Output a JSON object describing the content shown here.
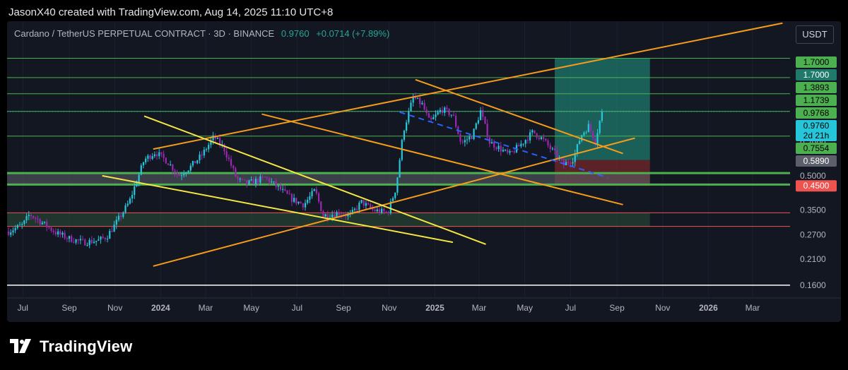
{
  "header": {
    "credit": "JasonX40 created with TradingView.com, Aug 14, 2025 11:10 UTC+8"
  },
  "legend": {
    "symbol": "Cardano / TetherUS PERPETUAL CONTRACT · 3D · BINANCE",
    "price": "0.9760",
    "change": "+0.0714 (+7.89%)"
  },
  "currency_button": "USDT",
  "brand": {
    "name": "TradingView"
  },
  "colors": {
    "pane_bg": "#131722",
    "up": "#26c6da",
    "down": "#9c27b0",
    "channel": "#f59c1a",
    "wedge": "#f5e642",
    "hline": "#4caf50",
    "hline_red": "#ef5350",
    "target_zone": "#1f7a6b",
    "stop_zone": "#7a2a2a",
    "trend_dashed": "#2962ff"
  },
  "chart_data": {
    "type": "candlestick",
    "title": "Cardano / TetherUS PERPETUAL CONTRACT · 3D · BINANCE",
    "y_scale": "log",
    "ylim": [
      0.14,
      2.5
    ],
    "xlim": [
      "2023-06-10",
      "2026-04-20"
    ],
    "x_ticks": [
      {
        "date": "2023-07-01",
        "label": "Jul",
        "bold": false
      },
      {
        "date": "2023-09-01",
        "label": "Sep",
        "bold": false
      },
      {
        "date": "2023-11-01",
        "label": "Nov",
        "bold": false
      },
      {
        "date": "2024-01-01",
        "label": "2024",
        "bold": true
      },
      {
        "date": "2024-03-01",
        "label": "Mar",
        "bold": false
      },
      {
        "date": "2024-05-01",
        "label": "May",
        "bold": false
      },
      {
        "date": "2024-07-01",
        "label": "Jul",
        "bold": false
      },
      {
        "date": "2024-09-01",
        "label": "Sep",
        "bold": false
      },
      {
        "date": "2024-11-01",
        "label": "Nov",
        "bold": false
      },
      {
        "date": "2025-01-01",
        "label": "2025",
        "bold": true
      },
      {
        "date": "2025-03-01",
        "label": "Mar",
        "bold": false
      },
      {
        "date": "2025-05-01",
        "label": "May",
        "bold": false
      },
      {
        "date": "2025-07-01",
        "label": "Jul",
        "bold": false
      },
      {
        "date": "2025-09-01",
        "label": "Sep",
        "bold": false
      },
      {
        "date": "2025-11-01",
        "label": "Nov",
        "bold": false
      },
      {
        "date": "2026-01-01",
        "label": "2026",
        "bold": true
      },
      {
        "date": "2026-03-01",
        "label": "Mar",
        "bold": false
      }
    ],
    "y_ticks": [
      "0.7000",
      "0.5000",
      "0.3500",
      "0.2700",
      "0.2100",
      "0.1600"
    ],
    "price_tags": [
      {
        "value": 1.7,
        "label": "1.7000",
        "bg": "#4caf50",
        "fg": "#000000"
      },
      {
        "value": 1.7,
        "label": "1.7000",
        "bg": "#1f7a6b",
        "fg": "#ffffff"
      },
      {
        "value": 1.3893,
        "label": "1.3893",
        "bg": "#4caf50",
        "fg": "#000000"
      },
      {
        "value": 1.1739,
        "label": "1.1739",
        "bg": "#4caf50",
        "fg": "#000000"
      },
      {
        "value": 0.9768,
        "label": "0.9768",
        "bg": "#4caf50",
        "fg": "#000000"
      },
      {
        "value": 0.976,
        "label": "0.9760",
        "sub": "2d 21h",
        "bg": "#26c6da",
        "fg": "#000000"
      },
      {
        "value": 0.7554,
        "label": "0.7554",
        "bg": "#4caf50",
        "fg": "#000000"
      },
      {
        "value": 0.589,
        "label": "0.5890",
        "bg": "#5d606b",
        "fg": "#ffffff"
      },
      {
        "value": 0.45,
        "label": "0.4500",
        "bg": "#ef5350",
        "fg": "#ffffff"
      }
    ],
    "horizontal_levels": [
      {
        "value": 1.7,
        "color": "#4caf50",
        "width": 1
      },
      {
        "value": 1.3893,
        "color": "#4caf50",
        "width": 1
      },
      {
        "value": 1.1739,
        "color": "#4caf50",
        "width": 1
      },
      {
        "value": 0.9768,
        "color": "#4caf50",
        "width": 1
      },
      {
        "value": 0.7554,
        "color": "#4caf50",
        "width": 1
      },
      {
        "value": 0.514,
        "color": "#4caf50",
        "width": 3
      },
      {
        "value": 0.456,
        "color": "#4caf50",
        "width": 3
      },
      {
        "value": 0.34,
        "color": "#ef5350",
        "width": 1
      },
      {
        "value": 0.295,
        "color": "#ef5350",
        "width": 1
      },
      {
        "value": 0.16,
        "color": "#ffffff",
        "width": 1.5
      }
    ],
    "zones": [
      {
        "from": "2025-06-10",
        "to": "2025-10-15",
        "y1": 0.589,
        "y2": 1.7,
        "color": "#1f7a6b",
        "opacity": 0.75
      },
      {
        "from": "2025-06-10",
        "to": "2025-10-15",
        "y1": 0.45,
        "y2": 0.589,
        "color": "#7a2a2a",
        "opacity": 0.7
      },
      {
        "from": "2023-06-10",
        "to": "2025-10-15",
        "y1": 0.456,
        "y2": 0.514,
        "color": "#5d606b",
        "opacity": 0.55
      },
      {
        "from": "2023-06-10",
        "to": "2025-10-15",
        "y1": 0.295,
        "y2": 0.34,
        "color": "#2e5a3c",
        "opacity": 0.45
      }
    ],
    "trendlines": [
      {
        "x1": "2023-12-22",
        "y1": 0.66,
        "x2": "2026-04-10",
        "y2": 2.45,
        "color": "#f59c1a",
        "dash": false
      },
      {
        "x1": "2023-12-22",
        "y1": 0.195,
        "x2": "2025-09-25",
        "y2": 0.74,
        "color": "#f59c1a",
        "dash": false
      },
      {
        "x1": "2024-12-06",
        "y1": 1.36,
        "x2": "2025-09-09",
        "y2": 0.63,
        "color": "#f59c1a",
        "dash": false
      },
      {
        "x1": "2024-05-15",
        "y1": 0.95,
        "x2": "2025-09-09",
        "y2": 0.37,
        "color": "#f59c1a",
        "dash": false
      },
      {
        "x1": "2023-12-10",
        "y1": 0.93,
        "x2": "2025-03-10",
        "y2": 0.245,
        "color": "#f5e642",
        "dash": false
      },
      {
        "x1": "2023-10-15",
        "y1": 0.5,
        "x2": "2025-01-25",
        "y2": 0.25,
        "color": "#f5e642",
        "dash": false
      },
      {
        "x1": "2024-11-15",
        "y1": 0.97,
        "x2": "2025-08-20",
        "y2": 0.49,
        "color": "#2962ff",
        "dash": true
      }
    ],
    "ohlc_anchors": [
      [
        "2023-06-12",
        0.28
      ],
      [
        "2023-07-01",
        0.3
      ],
      [
        "2023-07-10",
        0.335
      ],
      [
        "2023-07-25",
        0.31
      ],
      [
        "2023-08-15",
        0.275
      ],
      [
        "2023-09-01",
        0.26
      ],
      [
        "2023-09-20",
        0.25
      ],
      [
        "2023-10-10",
        0.255
      ],
      [
        "2023-10-21",
        0.265
      ],
      [
        "2023-11-01",
        0.3
      ],
      [
        "2023-11-20",
        0.38
      ],
      [
        "2023-12-10",
        0.59
      ],
      [
        "2023-12-25",
        0.64
      ],
      [
        "2024-01-10",
        0.58
      ],
      [
        "2024-01-25",
        0.5
      ],
      [
        "2024-02-10",
        0.55
      ],
      [
        "2024-02-25",
        0.62
      ],
      [
        "2024-03-12",
        0.75
      ],
      [
        "2024-03-25",
        0.67
      ],
      [
        "2024-04-12",
        0.48
      ],
      [
        "2024-04-25",
        0.46
      ],
      [
        "2024-05-20",
        0.49
      ],
      [
        "2024-06-10",
        0.43
      ],
      [
        "2024-06-25",
        0.39
      ],
      [
        "2024-07-10",
        0.37
      ],
      [
        "2024-07-25",
        0.43
      ],
      [
        "2024-08-05",
        0.33
      ],
      [
        "2024-08-25",
        0.34
      ],
      [
        "2024-09-10",
        0.33
      ],
      [
        "2024-09-25",
        0.38
      ],
      [
        "2024-10-10",
        0.35
      ],
      [
        "2024-10-30",
        0.34
      ],
      [
        "2024-11-10",
        0.44
      ],
      [
        "2024-11-20",
        0.8
      ],
      [
        "2024-12-03",
        1.13
      ],
      [
        "2024-12-15",
        1.05
      ],
      [
        "2024-12-25",
        0.87
      ],
      [
        "2025-01-10",
        1.0
      ],
      [
        "2025-01-25",
        0.94
      ],
      [
        "2025-02-05",
        0.7
      ],
      [
        "2025-02-20",
        0.76
      ],
      [
        "2025-03-03",
        0.98
      ],
      [
        "2025-03-15",
        0.71
      ],
      [
        "2025-03-30",
        0.66
      ],
      [
        "2025-04-10",
        0.62
      ],
      [
        "2025-04-25",
        0.69
      ],
      [
        "2025-05-12",
        0.79
      ],
      [
        "2025-05-25",
        0.73
      ],
      [
        "2025-06-10",
        0.63
      ],
      [
        "2025-06-22",
        0.56
      ],
      [
        "2025-07-05",
        0.6
      ],
      [
        "2025-07-15",
        0.76
      ],
      [
        "2025-07-25",
        0.84
      ],
      [
        "2025-08-03",
        0.72
      ],
      [
        "2025-08-12",
        0.976
      ]
    ]
  }
}
